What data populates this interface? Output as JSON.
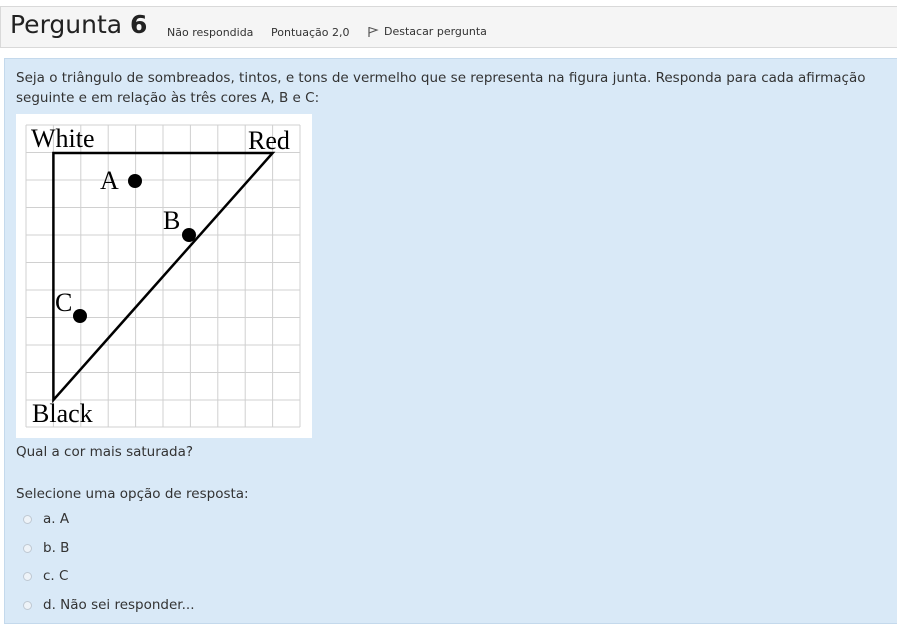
{
  "header": {
    "title_word": "Pergunta",
    "title_number": "6",
    "status": "Não respondida",
    "score": "Pontuação 2,0",
    "flag_label": "Destacar pergunta"
  },
  "question": {
    "text": "Seja o triângulo de sombreados, tintos, e tons de vermelho que se representa na figura junta. Responda para cada afirmação seguinte e em relação às três cores A, B e C:",
    "prompt": "Qual a cor mais saturada?",
    "select_label": "Selecione uma opção de resposta:"
  },
  "figure": {
    "corner_white": "White",
    "corner_red": "Red",
    "corner_black": "Black",
    "point_a": "A",
    "point_b": "B",
    "point_c": "C"
  },
  "options": [
    {
      "label": "a. A"
    },
    {
      "label": "b. B"
    },
    {
      "label": "c. C"
    },
    {
      "label": "d. Não sei responder..."
    }
  ]
}
